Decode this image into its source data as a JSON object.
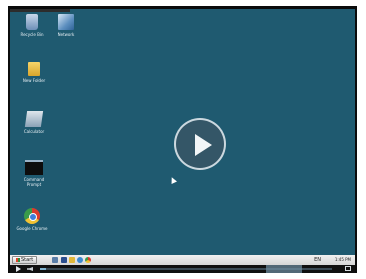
{
  "desktop": {
    "icons": [
      {
        "label": "Recycle Bin"
      },
      {
        "label": "Network"
      },
      {
        "label": "New Folder"
      },
      {
        "label": "Calculator"
      },
      {
        "label": "Command\nPrompt"
      },
      {
        "label": "Google Chrome"
      }
    ]
  },
  "player": {
    "play_icon": "play-icon",
    "progress": 0.02
  },
  "taskbar": {
    "start_label": "Start",
    "language": "EN",
    "clock": "1:45 PM"
  },
  "colors": {
    "desktop_bg": "#1f5a70",
    "taskbar_bg": "#e4e4e4"
  }
}
